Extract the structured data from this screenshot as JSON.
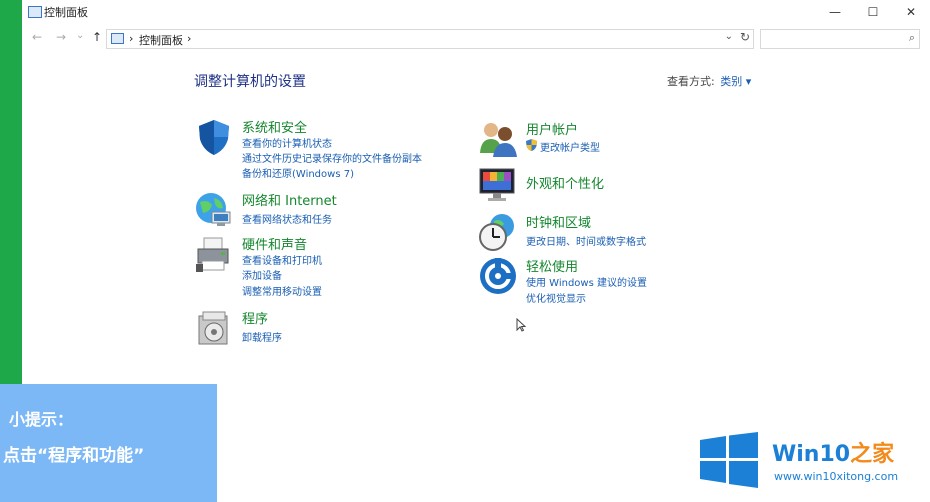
{
  "window": {
    "title": "控制面板",
    "minimize": "—",
    "maximize": "☐",
    "close": "✕"
  },
  "nav": {
    "back": "←",
    "forward": "→",
    "recent": "⌄",
    "up": "↑"
  },
  "address": {
    "sep1": "›",
    "crumb": "控制面板",
    "sep2": "›",
    "dropdown": "⌄",
    "refresh": "↻"
  },
  "search": {
    "icon": "⌕",
    "placeholder": ""
  },
  "main": {
    "heading": "调整计算机的设置",
    "view_by_label": "查看方式:",
    "view_by_value": "类别 ▾"
  },
  "categories": [
    {
      "title": "系统和安全",
      "icon": "shield-icon",
      "links": [
        "查看你的计算机状态",
        "通过文件历史记录保存你的文件备份副本",
        "备份和还原(Windows 7)"
      ]
    },
    {
      "title": "网络和 Internet",
      "icon": "network-globe-icon",
      "links": [
        "查看网络状态和任务"
      ]
    },
    {
      "title": "硬件和声音",
      "icon": "printer-icon",
      "links": [
        "查看设备和打印机",
        "添加设备",
        "调整常用移动设置"
      ]
    },
    {
      "title": "程序",
      "icon": "programs-icon",
      "links": [
        "卸载程序"
      ]
    },
    {
      "title": "用户帐户",
      "icon": "users-icon",
      "links": [
        "更改帐户类型"
      ]
    },
    {
      "title": "外观和个性化",
      "icon": "monitor-palette-icon",
      "links": []
    },
    {
      "title": "时钟和区域",
      "icon": "clock-globe-icon",
      "links": [
        "更改日期、时间或数字格式"
      ]
    },
    {
      "title": "轻松使用",
      "icon": "ease-of-access-icon",
      "links": [
        "使用 Windows 建议的设置",
        "优化视觉显示"
      ]
    }
  ],
  "tip": {
    "line1": "小提示：",
    "line2": "点击“程序和功能”"
  },
  "watermark": {
    "brand_a": "Win10",
    "brand_b": "之家",
    "site": "www.win10xitong.com"
  },
  "colors": {
    "accent_green": "#1fa84a",
    "link_blue": "#1a5fb4",
    "category_green": "#14872e",
    "tip_blue": "#7cb8f6",
    "brand_blue": "#1b80d6"
  }
}
